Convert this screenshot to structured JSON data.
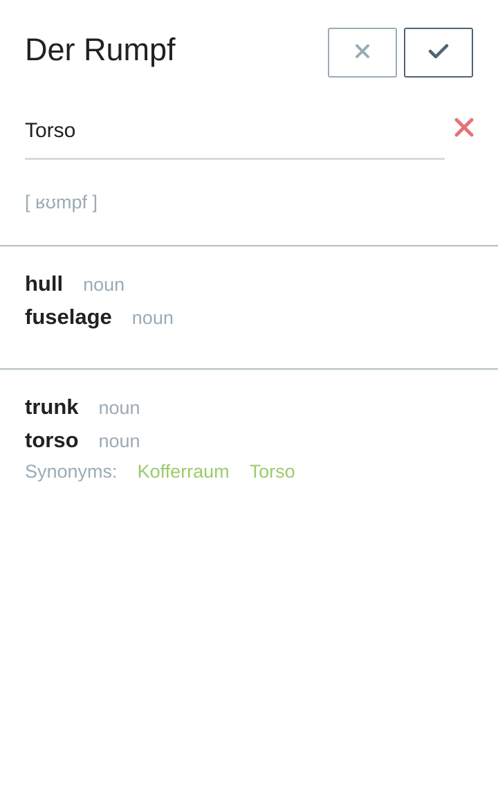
{
  "header": {
    "title": "Der Rumpf"
  },
  "translation": {
    "value": "Torso",
    "placeholder": ""
  },
  "phonetic": "[ ʁʊmpf ]",
  "groups": [
    {
      "entries": [
        {
          "word": "hull",
          "pos": "noun"
        },
        {
          "word": "fuselage",
          "pos": "noun"
        }
      ]
    },
    {
      "entries": [
        {
          "word": "trunk",
          "pos": "noun"
        },
        {
          "word": "torso",
          "pos": "noun"
        }
      ],
      "synonyms_label": "Synonyms:",
      "synonyms": [
        "Kofferraum",
        "Torso"
      ]
    }
  ],
  "colors": {
    "accent_green": "#9bcb6c",
    "clear_red": "#e57373",
    "muted": "#9aabb5",
    "confirm_dark": "#4f6472"
  },
  "icons": {
    "cancel": "close-icon",
    "confirm": "checkmark-icon",
    "clear": "clear-x-icon"
  }
}
